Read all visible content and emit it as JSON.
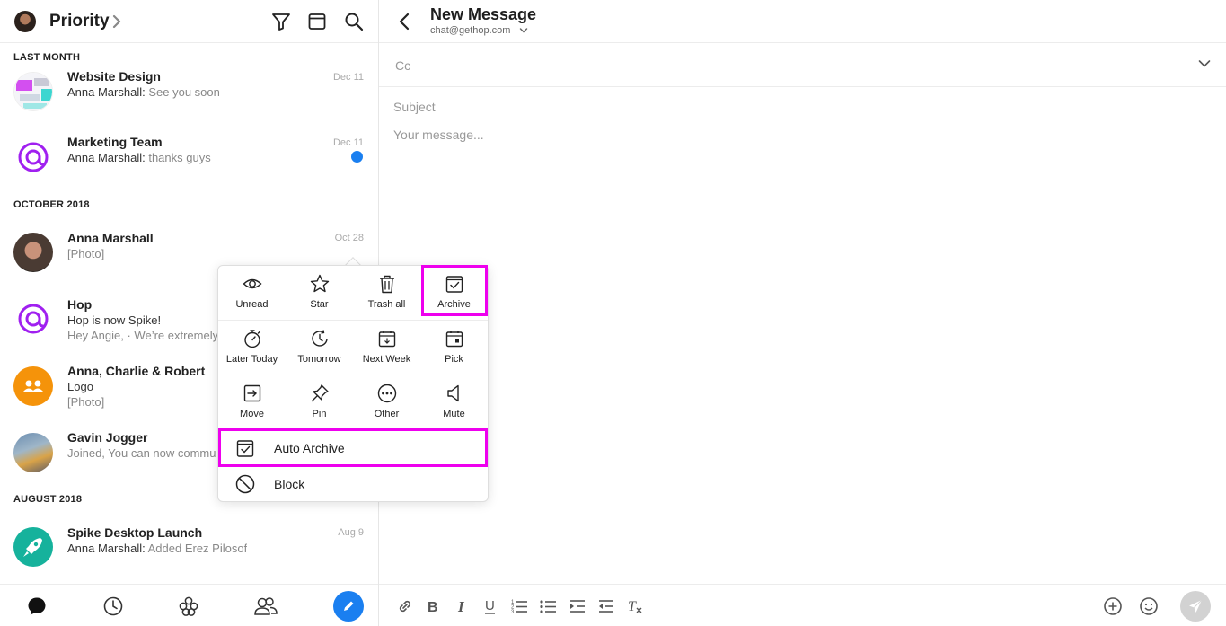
{
  "colors": {
    "accent": "#1a7ff0",
    "highlight": "#ee00ee",
    "purple": "#a020f0",
    "orange": "#f5930a",
    "teal": "#16b29c"
  },
  "left": {
    "title": "Priority",
    "sections": [
      {
        "label": "LAST MONTH"
      },
      {
        "label": "OCTOBER 2018"
      },
      {
        "label": "AUGUST 2018"
      }
    ],
    "conversations": [
      {
        "name": "Website Design",
        "sender": "Anna Marshall:",
        "preview": "See you soon",
        "date": "Dec 11"
      },
      {
        "name": "Marketing Team",
        "sender": "Anna Marshall:",
        "preview": "thanks guys",
        "date": "Dec 11",
        "unread": true
      },
      {
        "name": "Anna Marshall",
        "preview": "[Photo]",
        "date": "Oct 28"
      },
      {
        "name": "Hop",
        "line1": "Hop is now Spike!",
        "preview": "Hey Angie, · We’re extremely"
      },
      {
        "name": "Anna, Charlie & Robert",
        "line1": "Logo",
        "preview": "[Photo]"
      },
      {
        "name": "Gavin Jogger",
        "preview": "Joined, You can now commu"
      },
      {
        "name": "Spike Desktop Launch",
        "sender": "Anna Marshall:",
        "preview": "Added Erez Pilosof",
        "date": "Aug 9"
      }
    ]
  },
  "compose": {
    "title": "New Message",
    "from": "chat@gethop.com",
    "cc_label": "Cc",
    "subject_placeholder": "Subject",
    "message_placeholder": "Your message..."
  },
  "menu": {
    "row1": [
      "Unread",
      "Star",
      "Trash all",
      "Archive"
    ],
    "row2": [
      "Later Today",
      "Tomorrow",
      "Next Week",
      "Pick"
    ],
    "row3": [
      "Move",
      "Pin",
      "Other",
      "Mute"
    ],
    "auto_archive": "Auto Archive",
    "block": "Block"
  }
}
